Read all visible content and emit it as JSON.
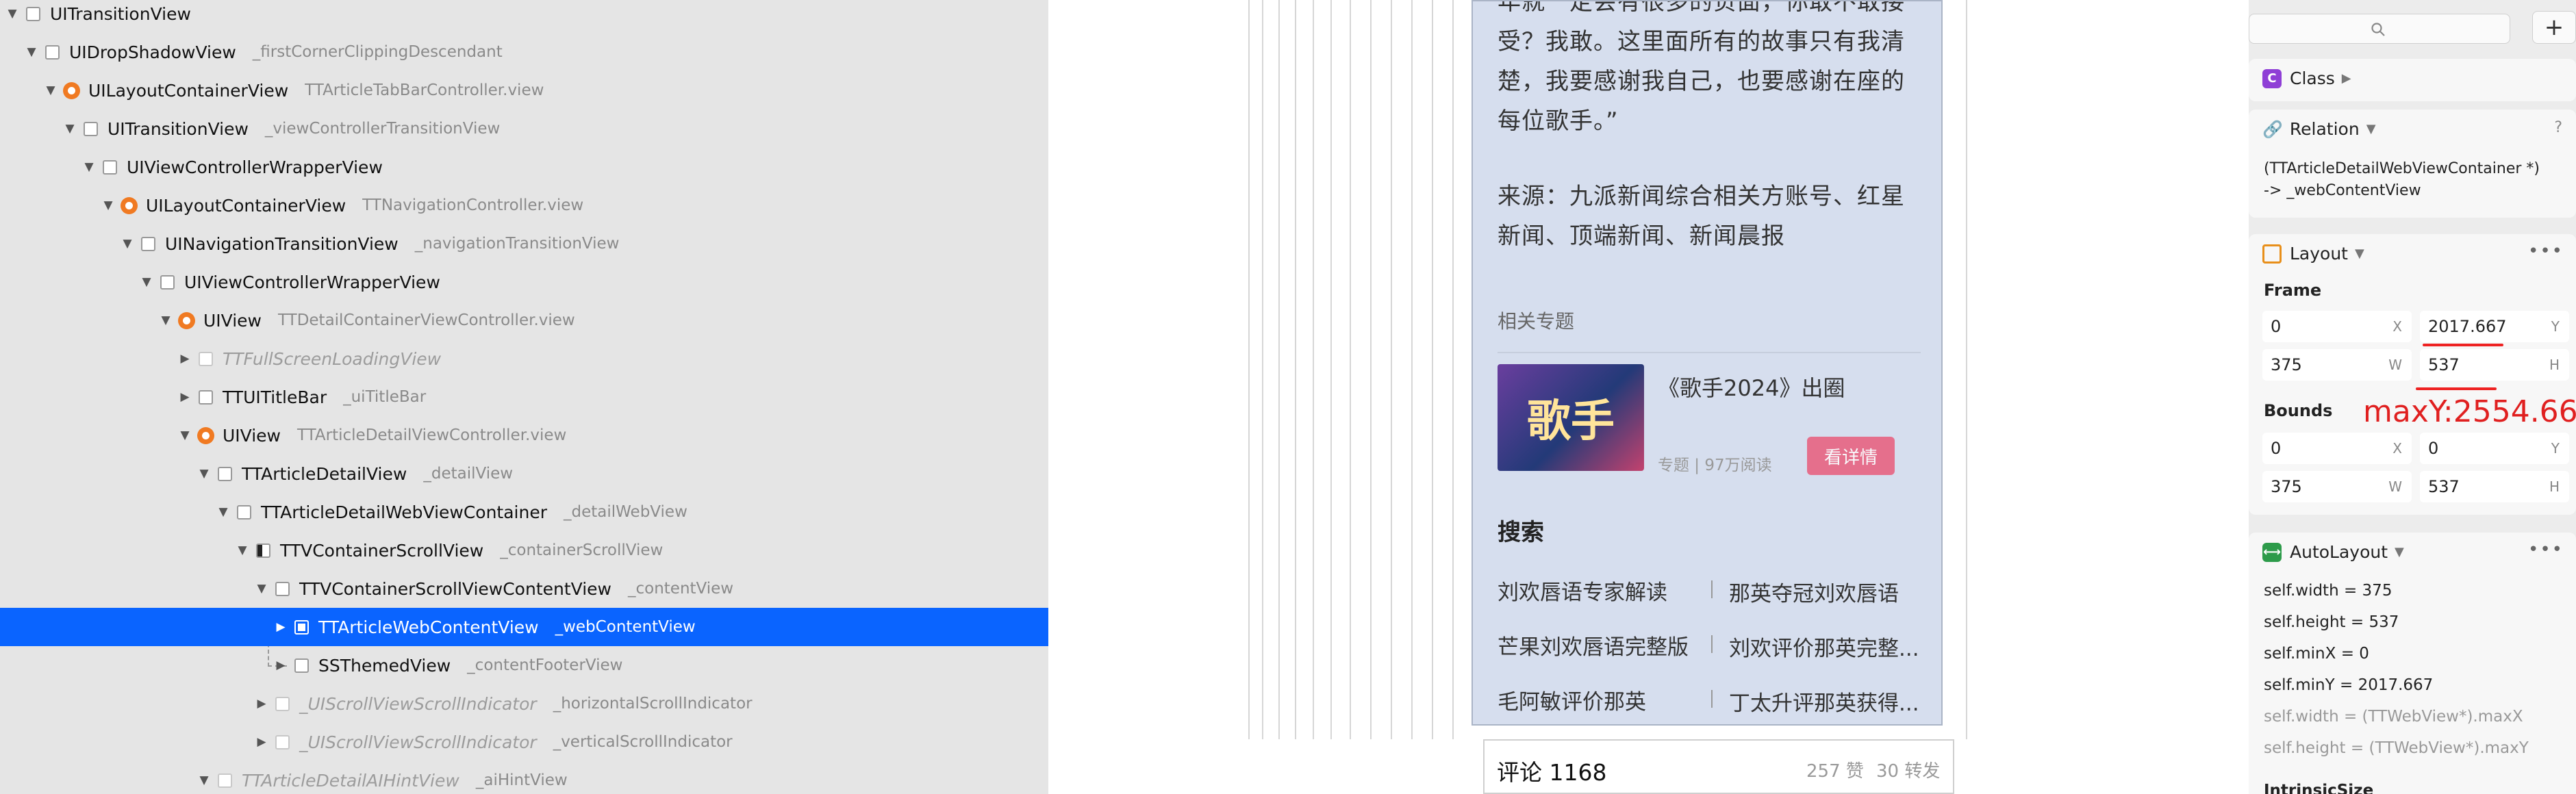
{
  "hierarchy": {
    "rows": [
      {
        "cls": "UITransitionView",
        "var": ""
      },
      {
        "cls": "UIDropShadowView",
        "var": "_firstCornerClippingDescendant"
      },
      {
        "cls": "UILayoutContainerView",
        "var": "TTArticleTabBarController.view"
      },
      {
        "cls": "UITransitionView",
        "var": "_viewControllerTransitionView"
      },
      {
        "cls": "UIViewControllerWrapperView",
        "var": ""
      },
      {
        "cls": "UILayoutContainerView",
        "var": "TTNavigationController.view"
      },
      {
        "cls": "UINavigationTransitionView",
        "var": "_navigationTransitionView"
      },
      {
        "cls": "UIViewControllerWrapperView",
        "var": ""
      },
      {
        "cls": "UIView",
        "var": "TTDetailContainerViewController.view"
      },
      {
        "cls": "TTFullScreenLoadingView",
        "var": ""
      },
      {
        "cls": "TTUITitleBar",
        "var": "_uiTitleBar"
      },
      {
        "cls": "UIView",
        "var": "TTArticleDetailViewController.view"
      },
      {
        "cls": "TTArticleDetailView",
        "var": "_detailView"
      },
      {
        "cls": "TTArticleDetailWebViewContainer",
        "var": "_detailWebView"
      },
      {
        "cls": "TTVContainerScrollView",
        "var": "_containerScrollView"
      },
      {
        "cls": "TTVContainerScrollViewContentView",
        "var": "_contentView"
      },
      {
        "cls": "TTArticleWebContentView",
        "var": "_webContentView"
      },
      {
        "cls": "SSThemedView",
        "var": "_contentFooterView"
      },
      {
        "cls": "_UIScrollViewScrollIndicator",
        "var": "_horizontalScrollIndicator"
      },
      {
        "cls": "_UIScrollViewScrollIndicator",
        "var": "_verticalScrollIndicator"
      },
      {
        "cls": "TTArticleDetailAIHintView",
        "var": "_aiHintView"
      }
    ]
  },
  "article": {
    "para1": "年就一定会有很多的负面，你敢不敢接受？我敢。这里面所有的故事只有我清楚，我要感谢我自己，也要感谢在座的每位歌手。”",
    "para2": "来源：九派新闻综合相关方账号、红星新闻、顶端新闻、新闻晨报",
    "related_label": "相关专题",
    "thumb_text": "歌手",
    "topic_title": "《歌手2024》出圈",
    "topic_meta": "专题 | 97万阅读",
    "detail_button": "看详情",
    "search_title": "搜索",
    "suggestions": [
      "刘欢唇语专家解读",
      "那英夺冠刘欢唇语",
      "芒果刘欢唇语完整版",
      "刘欢评价那英完整...",
      "毛阿敏评价那英",
      "丁太升评那英获得..."
    ],
    "comment_title": "评论 1168",
    "likes": "257 赞",
    "reposts": "30 转发"
  },
  "inspector": {
    "class_label": "Class",
    "relation_label": "Relation",
    "relation_help": "?",
    "relation_text_1": "(TTArticleDetailWebViewContainer *)",
    "relation_text_2": "-> _webContentView",
    "layout_label": "Layout",
    "frame_label": "Frame",
    "frame": {
      "x": "0",
      "y": "2017.667",
      "w": "375",
      "h": "537"
    },
    "bounds_label": "Bounds",
    "bounds": {
      "x": "0",
      "y": "0",
      "w": "375",
      "h": "537"
    },
    "unit_x": "X",
    "unit_y": "Y",
    "unit_w": "W",
    "unit_h": "H",
    "maxy_annotation": "maxY:2554.66",
    "autolayout_label": "AutoLayout",
    "autolayout_lines": [
      "self.width = 375",
      "self.height = 537",
      "self.minX = 0",
      "self.minY = 2017.667",
      "self.width = (TTWebView*).maxX",
      "self.height = (TTWebView*).maxY"
    ],
    "intrinsic_label": "IntrinsicSize"
  },
  "colors": {
    "selection": "#0a64ff",
    "accent_orange": "#f07a22",
    "annotation_red": "#e02020"
  }
}
